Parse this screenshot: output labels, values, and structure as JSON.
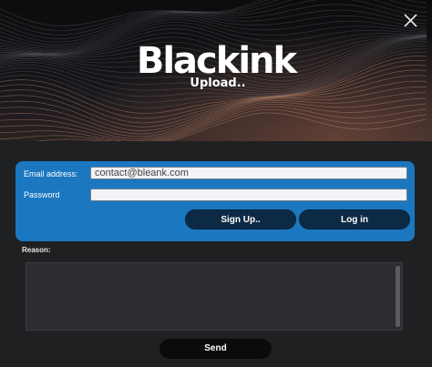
{
  "window": {
    "logo_text": "Blackink",
    "subtitle": "Upload..",
    "close_icon": "close-icon"
  },
  "form": {
    "email_label": "Email address:",
    "email_value": "contact@bleank.com",
    "password_label": "Password",
    "password_value": "",
    "signup_label": "Sign Up..",
    "login_label": "Log in"
  },
  "reason": {
    "label": "Reason:",
    "value": ""
  },
  "actions": {
    "send_label": "Send"
  },
  "colors": {
    "panel_blue": "#1b77c0",
    "button_dark": "#0d2a45",
    "background": "#1f2022"
  }
}
